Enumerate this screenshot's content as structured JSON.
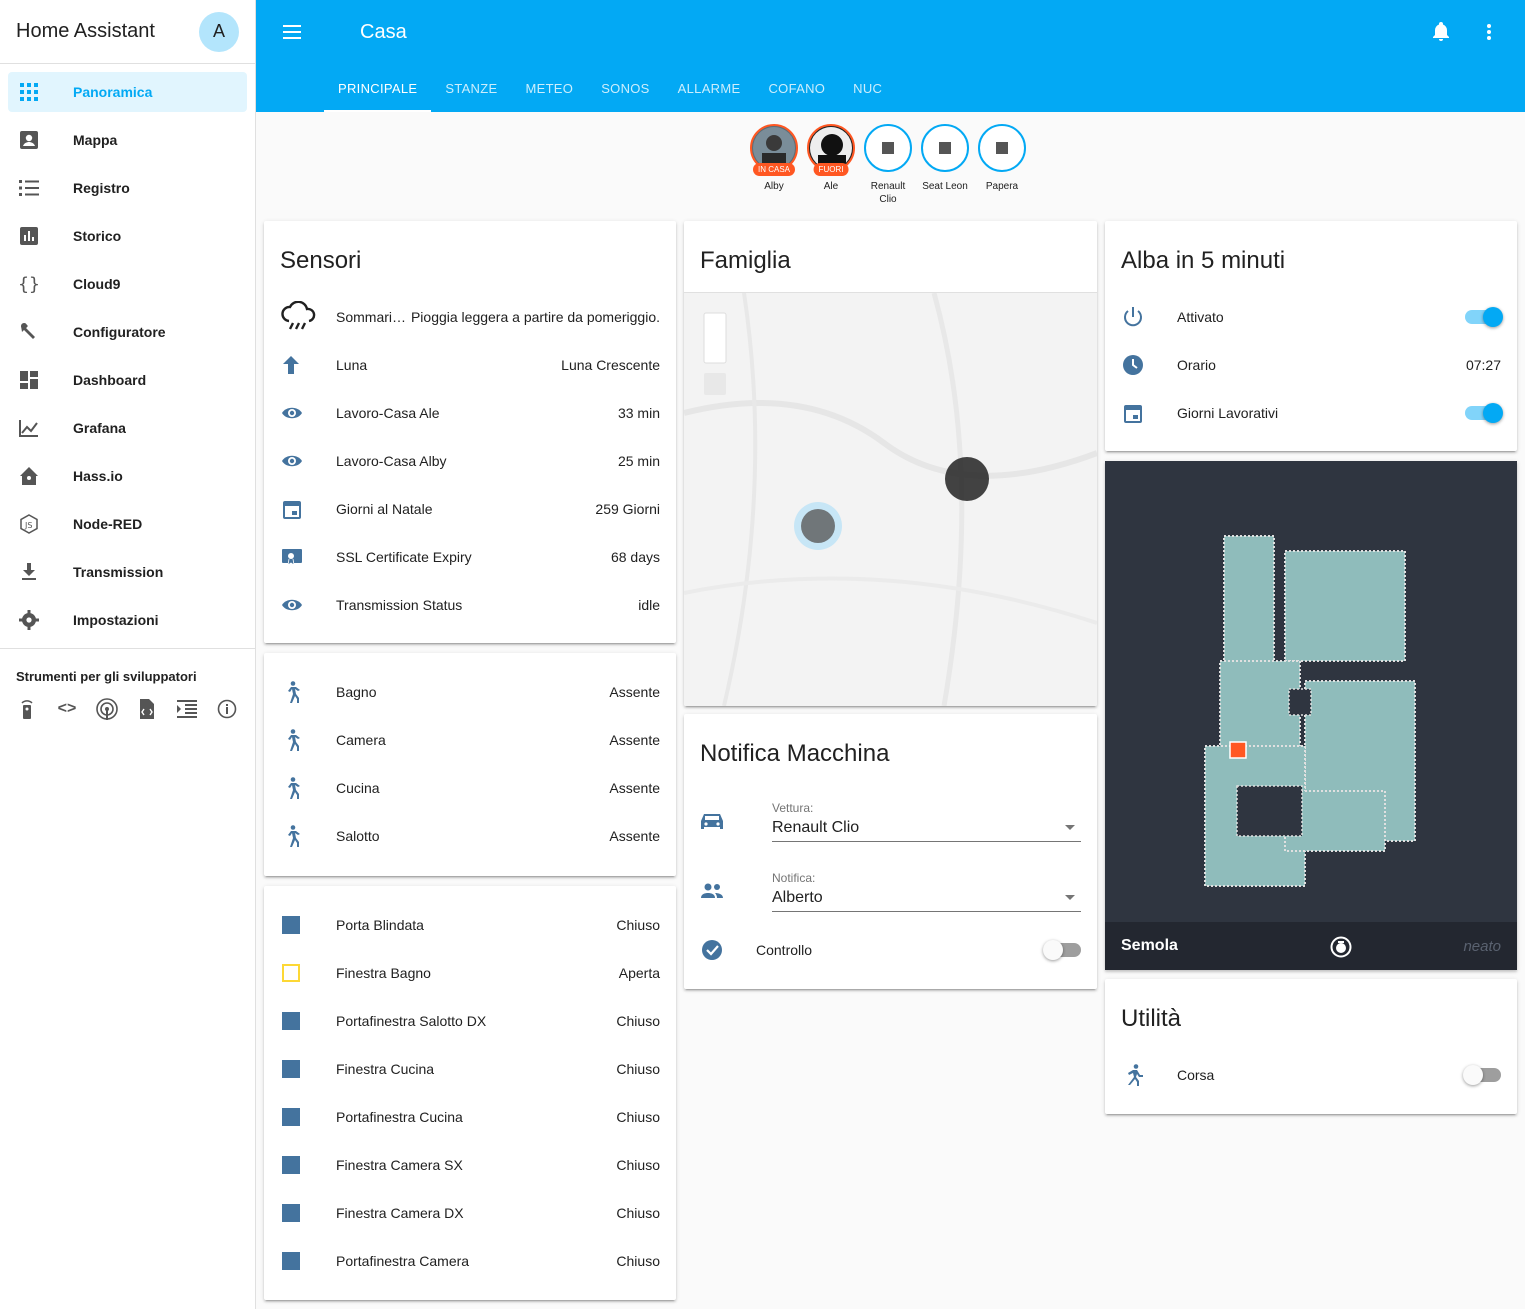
{
  "app": {
    "title": "Home Assistant",
    "avatar_letter": "A"
  },
  "sidebar": {
    "items": [
      {
        "label": "Panoramica",
        "icon": "apps-icon",
        "active": true
      },
      {
        "label": "Mappa",
        "icon": "account-box-icon"
      },
      {
        "label": "Registro",
        "icon": "format-list-bulleted-icon"
      },
      {
        "label": "Storico",
        "icon": "poll-box-icon"
      },
      {
        "label": "Cloud9",
        "icon": "code-braces-icon"
      },
      {
        "label": "Configuratore",
        "icon": "wrench-icon"
      },
      {
        "label": "Dashboard",
        "icon": "view-dashboard-icon"
      },
      {
        "label": "Grafana",
        "icon": "chart-line-icon"
      },
      {
        "label": "Hass.io",
        "icon": "home-assistant-icon"
      },
      {
        "label": "Node-RED",
        "icon": "nodejs-icon"
      },
      {
        "label": "Transmission",
        "icon": "download-icon"
      },
      {
        "label": "Impostazioni",
        "icon": "settings-icon"
      }
    ],
    "dev_tools_title": "Strumenti per gli sviluppatori",
    "dev_tools": [
      "remote-icon",
      "code-tags-icon",
      "access-point-icon",
      "file-xml-icon",
      "format-indent-icon",
      "info-outline-icon"
    ]
  },
  "header": {
    "title": "Casa",
    "tabs": [
      "PRINCIPALE",
      "STANZE",
      "METEO",
      "SONOS",
      "ALLARME",
      "COFANO",
      "NUC"
    ],
    "active_tab": "PRINCIPALE",
    "accent": "#03a9f4"
  },
  "badges": [
    {
      "label": "Alby",
      "tag": "IN CASA",
      "kind": "person"
    },
    {
      "label": "Ale",
      "tag": "FUORI",
      "kind": "person"
    },
    {
      "label": "Renault Clio",
      "kind": "entity"
    },
    {
      "label": "Seat Leon",
      "kind": "entity"
    },
    {
      "label": "Papera",
      "kind": "entity"
    }
  ],
  "sensori": {
    "title": "Sensori",
    "rows": [
      {
        "name": "Sommari…",
        "state": "Pioggia leggera a partire da pomeriggio.",
        "icon": "weather-rainy-icon"
      },
      {
        "name": "Luna",
        "state": "Luna Crescente",
        "icon": "arrow-up-icon"
      },
      {
        "name": "Lavoro-Casa Ale",
        "state": "33 min",
        "icon": "eye-icon"
      },
      {
        "name": "Lavoro-Casa Alby",
        "state": "25 min",
        "icon": "eye-icon"
      },
      {
        "name": "Giorni al Natale",
        "state": "259 Giorni",
        "icon": "calendar-icon"
      },
      {
        "name": "SSL Certificate Expiry",
        "state": "68 days",
        "icon": "certificate-icon"
      },
      {
        "name": "Transmission Status",
        "state": "idle",
        "icon": "eye-icon"
      }
    ]
  },
  "motion": {
    "rows": [
      {
        "name": "Bagno",
        "state": "Assente"
      },
      {
        "name": "Camera",
        "state": "Assente"
      },
      {
        "name": "Cucina",
        "state": "Assente"
      },
      {
        "name": "Salotto",
        "state": "Assente"
      }
    ]
  },
  "openings": {
    "rows": [
      {
        "name": "Porta Blindata",
        "state": "Chiuso",
        "open": false
      },
      {
        "name": "Finestra Bagno",
        "state": "Aperta",
        "open": true
      },
      {
        "name": "Portafinestra Salotto DX",
        "state": "Chiuso",
        "open": false
      },
      {
        "name": "Finestra Cucina",
        "state": "Chiuso",
        "open": false
      },
      {
        "name": "Portafinestra Cucina",
        "state": "Chiuso",
        "open": false
      },
      {
        "name": "Finestra Camera SX",
        "state": "Chiuso",
        "open": false
      },
      {
        "name": "Finestra Camera DX",
        "state": "Chiuso",
        "open": false
      },
      {
        "name": "Portafinestra Camera",
        "state": "Chiuso",
        "open": false
      }
    ]
  },
  "famiglia": {
    "title": "Famiglia"
  },
  "notifica": {
    "title": "Notifica Macchina",
    "vettura_label": "Vettura:",
    "vettura_value": "Renault Clio",
    "notifica_label": "Notifica:",
    "notifica_value": "Alberto",
    "controllo_label": "Controllo",
    "controllo_on": false
  },
  "alba": {
    "title": "Alba in 5 minuti",
    "attivato_label": "Attivato",
    "orario_label": "Orario",
    "orario_value": "07:27",
    "giorni_label": "Giorni Lavorativi"
  },
  "vacuum": {
    "name": "Semola",
    "brand": "neato"
  },
  "utilita": {
    "title": "Utilità",
    "corsa_label": "Corsa"
  }
}
